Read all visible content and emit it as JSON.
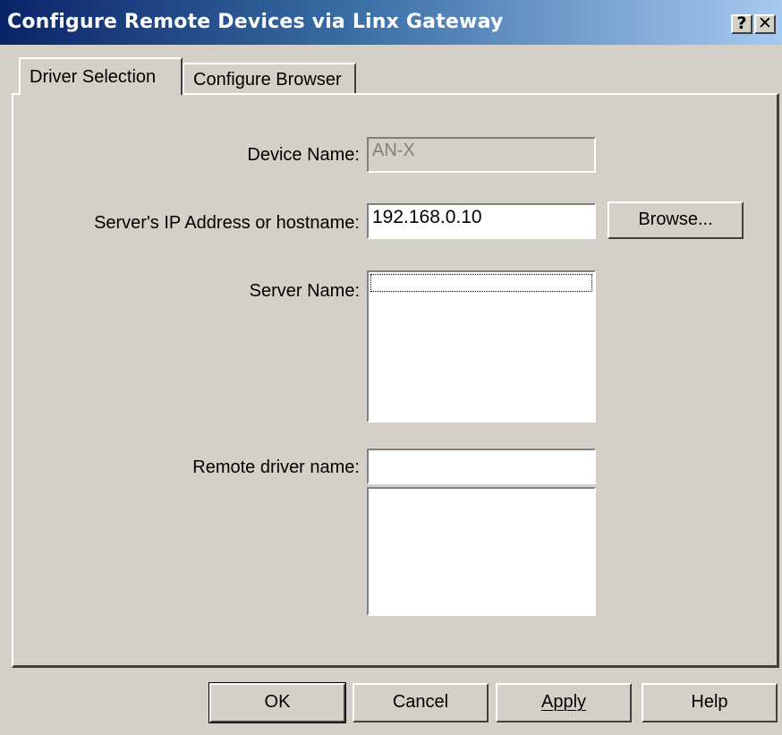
{
  "window": {
    "title": "Configure Remote Devices via Linx Gateway",
    "help_btn": "?",
    "close_btn": "✕"
  },
  "tabs": [
    {
      "label": "Driver Selection",
      "active": true
    },
    {
      "label": "Configure Browser",
      "active": false
    }
  ],
  "form": {
    "device_name_label": "Device Name:",
    "device_name_value": "AN-X",
    "ip_label": "Server's IP Address or hostname:",
    "ip_value": "192.168.0.10",
    "browse_label": "Browse...",
    "server_name_label": "Server Name:",
    "remote_driver_label": "Remote driver name:",
    "remote_driver_value": ""
  },
  "buttons": {
    "ok": "OK",
    "cancel": "Cancel",
    "apply": "Apply",
    "help": "Help"
  },
  "colors": {
    "face": "#d4d0c8",
    "title_start": "#0a246a",
    "title_end": "#a6caf0"
  }
}
